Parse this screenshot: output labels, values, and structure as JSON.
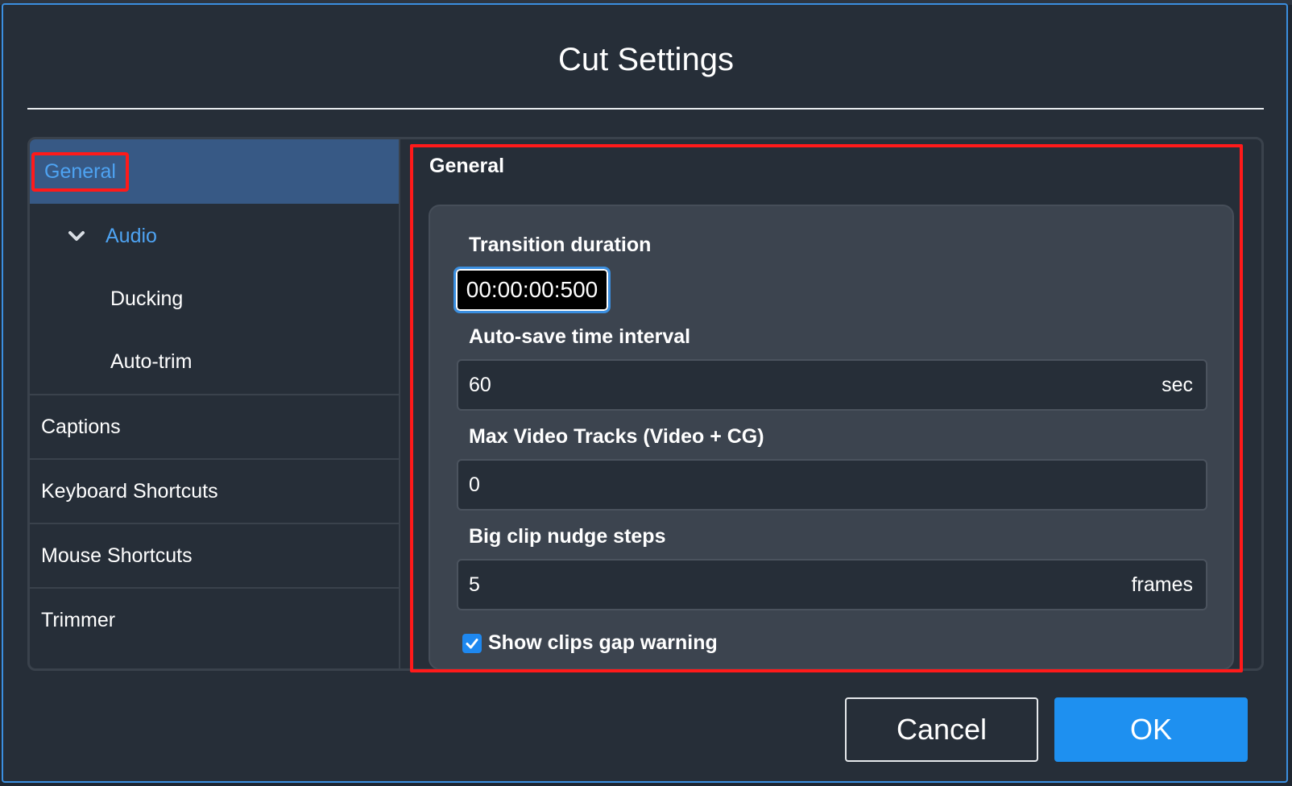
{
  "dialog": {
    "title": "Cut Settings"
  },
  "sidebar": {
    "items": [
      {
        "label": "General",
        "active": true
      },
      {
        "label": "Audio",
        "expanded": true,
        "icon": "chevron-down-icon"
      },
      {
        "label": "Ducking"
      },
      {
        "label": "Auto-trim"
      },
      {
        "label": "Captions"
      },
      {
        "label": "Keyboard Shortcuts"
      },
      {
        "label": "Mouse Shortcuts"
      },
      {
        "label": "Trimmer"
      }
    ]
  },
  "panel": {
    "title": "General",
    "fields": {
      "transition_duration": {
        "label": "Transition duration",
        "value": "00:00:00:500"
      },
      "autosave_interval": {
        "label": "Auto-save time interval",
        "value": "60",
        "unit": "sec"
      },
      "max_video_tracks": {
        "label": "Max Video Tracks (Video + CG)",
        "value": "0"
      },
      "big_clip_nudge": {
        "label": "Big clip nudge steps",
        "value": "5",
        "unit": "frames"
      },
      "show_gap_warning": {
        "label": "Show clips gap warning",
        "checked": true
      }
    }
  },
  "buttons": {
    "cancel": "Cancel",
    "ok": "OK"
  },
  "colors": {
    "accent": "#1e90f0",
    "highlight": "#ff1a1a",
    "active_item": "#375985"
  }
}
